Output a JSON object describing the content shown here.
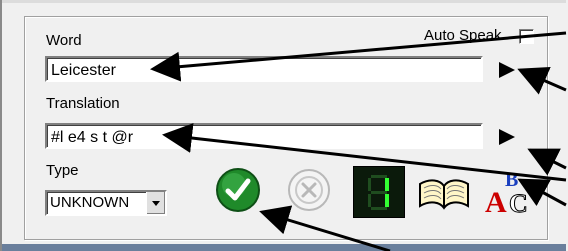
{
  "word": {
    "label": "Word",
    "value": "Leicester"
  },
  "auto_speak": {
    "label": "Auto Speak",
    "checked": false
  },
  "translation": {
    "label": "Translation",
    "value": "#l e4 s t @r"
  },
  "type": {
    "label": "Type",
    "selected": "UNKNOWN"
  },
  "counter": {
    "digit": "1"
  },
  "icons": {
    "accept": "check-circle-icon",
    "reject": "x-circle-icon",
    "counter": "seven-segment-display-icon",
    "dictionary": "open-book-icon",
    "spellcheck": "abc-spellcheck-icon",
    "play": "play-triangle-icon"
  },
  "colors": {
    "accept_green": "#1f8a2a",
    "counter_bg": "#0b1a0b",
    "counter_digit": "#33ff33",
    "spell_red": "#cc0000",
    "spell_blue": "#1a3fbf"
  }
}
